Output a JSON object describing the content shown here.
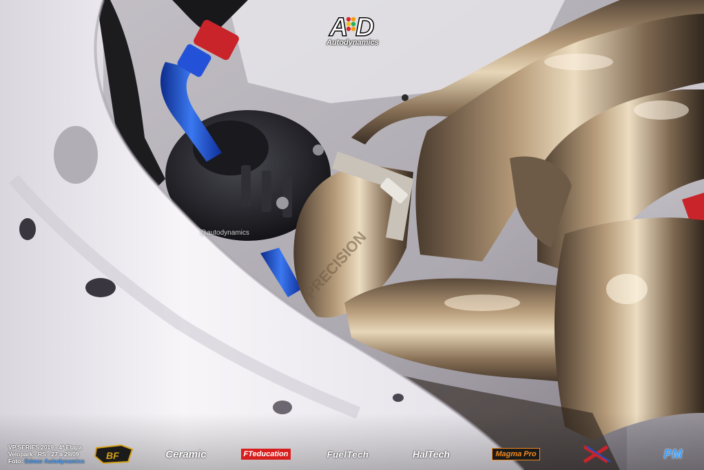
{
  "watermark": {
    "logo_mark": "A D",
    "logo_name": "Autodynamics",
    "handle": "@autodynamics"
  },
  "caption": {
    "line1": "VP SERIES 2019 - 4ª Etapa",
    "line2": "Velopark - RS - 27 a 29/09",
    "line3_label": "Foto: ",
    "line3_credit": "Edmar Autodynamics"
  },
  "sponsors": [
    {
      "name": "BF Racing"
    },
    {
      "name": "Ceramic Power"
    },
    {
      "name": "FTeducation"
    },
    {
      "name": "FuelTech"
    },
    {
      "name": "HalTech"
    },
    {
      "name": "Magma Pro"
    },
    {
      "name": "X-Race"
    },
    {
      "name": "PM Cambio"
    }
  ],
  "colors": {
    "accent_blue": "#4aa3ff",
    "anodized_blue": "#1f4fd1",
    "anodized_red": "#c8242a"
  }
}
